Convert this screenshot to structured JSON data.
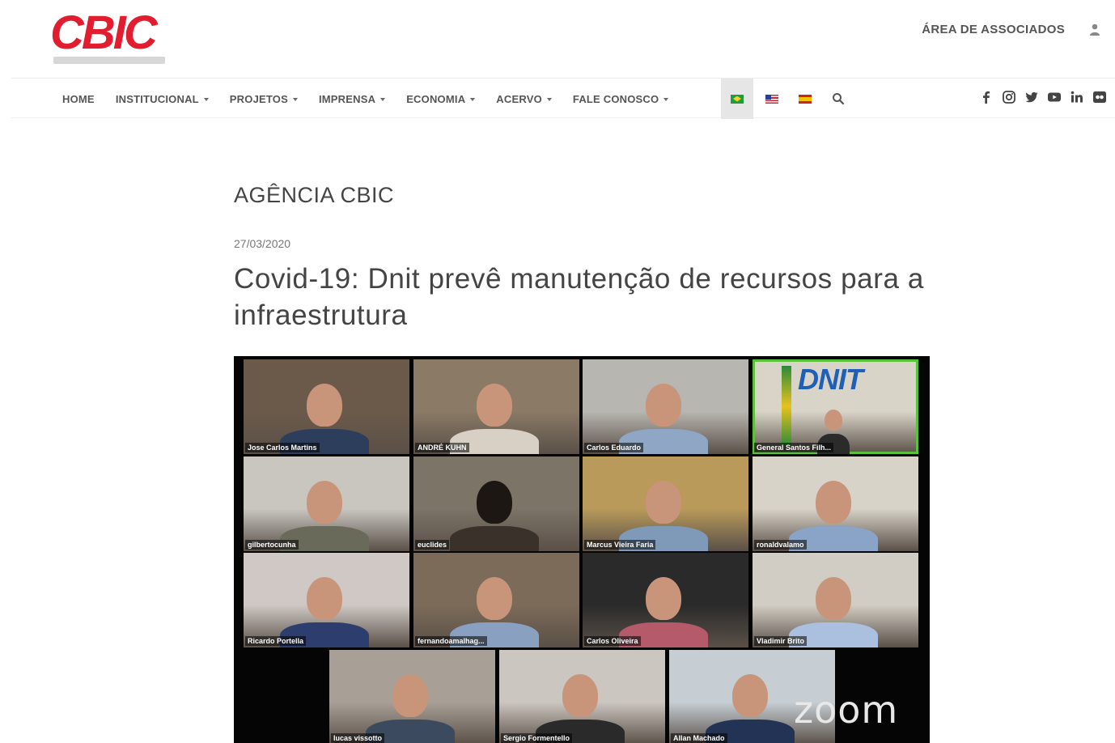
{
  "header": {
    "logo_text": "CBIC",
    "associates_link": "ÁREA DE ASSOCIADOS"
  },
  "nav": {
    "items": [
      {
        "label": "HOME",
        "dropdown": false
      },
      {
        "label": "INSTITUCIONAL",
        "dropdown": true
      },
      {
        "label": "PROJETOS",
        "dropdown": true
      },
      {
        "label": "IMPRENSA",
        "dropdown": true
      },
      {
        "label": "ECONOMIA",
        "dropdown": true
      },
      {
        "label": "ACERVO",
        "dropdown": true
      },
      {
        "label": "FALE CONOSCO",
        "dropdown": true
      }
    ],
    "languages": [
      "brazil-flag-icon",
      "usa-flag-icon",
      "spain-flag-icon"
    ],
    "active_language": "brazil-flag-icon",
    "socials": [
      "facebook-icon",
      "instagram-icon",
      "twitter-icon",
      "youtube-icon",
      "linkedin-icon",
      "flickr-icon"
    ]
  },
  "article": {
    "section": "AGÊNCIA CBIC",
    "date": "27/03/2020",
    "title": "Covid-19: Dnit prevê manutenção de recursos para a infraestrutura"
  },
  "meeting": {
    "platform_logo": "zoom",
    "participants": [
      {
        "name": "Jose Carlos Martins",
        "bg": "#6b5a4a"
      },
      {
        "name": "ANDRÉ KUHN",
        "bg": "#8a7a66"
      },
      {
        "name": "Carlos Eduardo",
        "bg": "#b8b6b0"
      },
      {
        "name": "General Santos Filh...",
        "bg": "#d9d4c8",
        "active": true
      },
      {
        "name": "gilbertocunha",
        "bg": "#c9c6c0"
      },
      {
        "name": "euclides",
        "bg": "#7d7468"
      },
      {
        "name": "Marcus Vieira Faria",
        "bg": "#b99a5a"
      },
      {
        "name": "ronaldvalamo",
        "bg": "#d8d3c8"
      },
      {
        "name": "Ricardo Portella",
        "bg": "#cfc8c4"
      },
      {
        "name": "fernandoamalhag...",
        "bg": "#7b6b58"
      },
      {
        "name": "Carlos Oliveira",
        "bg": "#2a2a2a"
      },
      {
        "name": "Vladimir Brito",
        "bg": "#d2cdc4"
      },
      {
        "name": "lucas vissotto",
        "bg": "#a8a096"
      },
      {
        "name": "Sergio Formentello",
        "bg": "#cbc6bf"
      },
      {
        "name": "Allan Machado",
        "bg": "#c6ced4"
      }
    ]
  }
}
